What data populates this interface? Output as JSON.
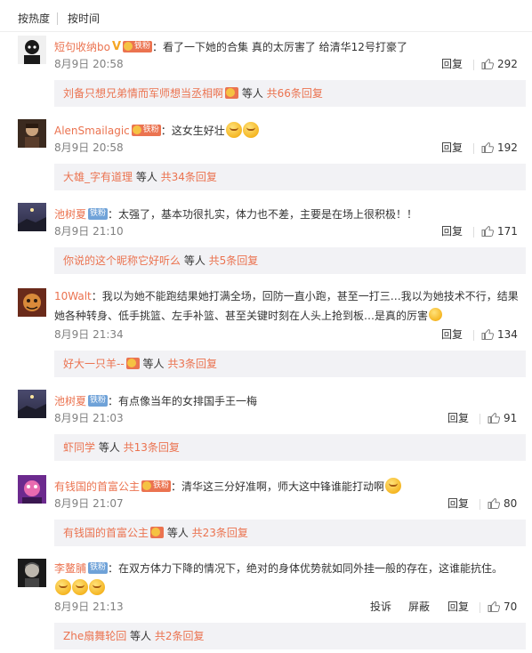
{
  "sort": {
    "hot": "按热度",
    "time": "按时间"
  },
  "colors": {
    "accent": "#eb7350",
    "reply_bg": "#f2f2f5",
    "iron_badge": "#6fa2d8"
  },
  "comments": [
    {
      "user": "短句收纳bo",
      "badge": "铁粉",
      "text": "：看了一下她的合集 真的太厉害了 给清华12号打豪了",
      "time": "8月9日 20:58",
      "reply_label": "回复",
      "likes": "292",
      "replies": {
        "names": "刘备只想兄弟情而军师想当丞相啊",
        "mid": " 等人 ",
        "count": "共66条回复"
      }
    },
    {
      "user": "AlenSmailagic",
      "badge": "铁粉",
      "text": "：这女生好壮",
      "time": "8月9日 20:58",
      "reply_label": "回复",
      "likes": "192",
      "replies": {
        "names": "大雄_字有道理",
        "mid": " 等人 ",
        "count": "共34条回复"
      }
    },
    {
      "user": "池树夏",
      "badge": "铁粉",
      "text": "：太强了，基本功很扎实，体力也不差，主要是在场上很积极！！",
      "time": "8月9日 21:10",
      "reply_label": "回复",
      "likes": "171",
      "replies": {
        "names": "你说的这个昵称它好听么",
        "mid": " 等人 ",
        "count": "共5条回复"
      }
    },
    {
      "user": "10Walt",
      "text_line1": "：我以为她不能跑结果她打满全场，回防一直小跑，甚至一打三…我以为她技术不行，结果",
      "text_line2": "她各种转身、低手挑篮、左手补篮、甚至关键时刻在人头上抢到板…是真的厉害",
      "time": "8月9日 21:34",
      "reply_label": "回复",
      "likes": "134",
      "replies": {
        "names": "好大一只羊--",
        "mid": " 等人 ",
        "count": "共3条回复"
      }
    },
    {
      "user": "池树夏",
      "badge": "铁粉",
      "text": "：有点像当年的女排国手王一梅",
      "time": "8月9日 21:03",
      "reply_label": "回复",
      "likes": "91",
      "replies": {
        "names": "虾同学",
        "mid": " 等人 ",
        "count": "共13条回复"
      }
    },
    {
      "user": "有钱国的首富公主",
      "badge": "铁粉",
      "text": "：清华这三分好准啊，师大这中锋谁能打动啊",
      "time": "8月9日 21:07",
      "reply_label": "回复",
      "likes": "80",
      "replies": {
        "names": "有钱国的首富公主",
        "mid": " 等人 ",
        "count": "共23条回复"
      }
    },
    {
      "user": "李鳌脯",
      "badge": "铁粉",
      "text": "：在双方体力下降的情况下，绝对的身体优势就如同外挂一般的存在，这谁能抗住。",
      "time": "8月9日 21:13",
      "report_label": "投诉",
      "block_label": "屏蔽",
      "reply_label": "回复",
      "likes": "70",
      "replies": {
        "names": "Zhe扇舞轮回",
        "mid": " 等人 ",
        "count": "共2条回复"
      }
    }
  ]
}
